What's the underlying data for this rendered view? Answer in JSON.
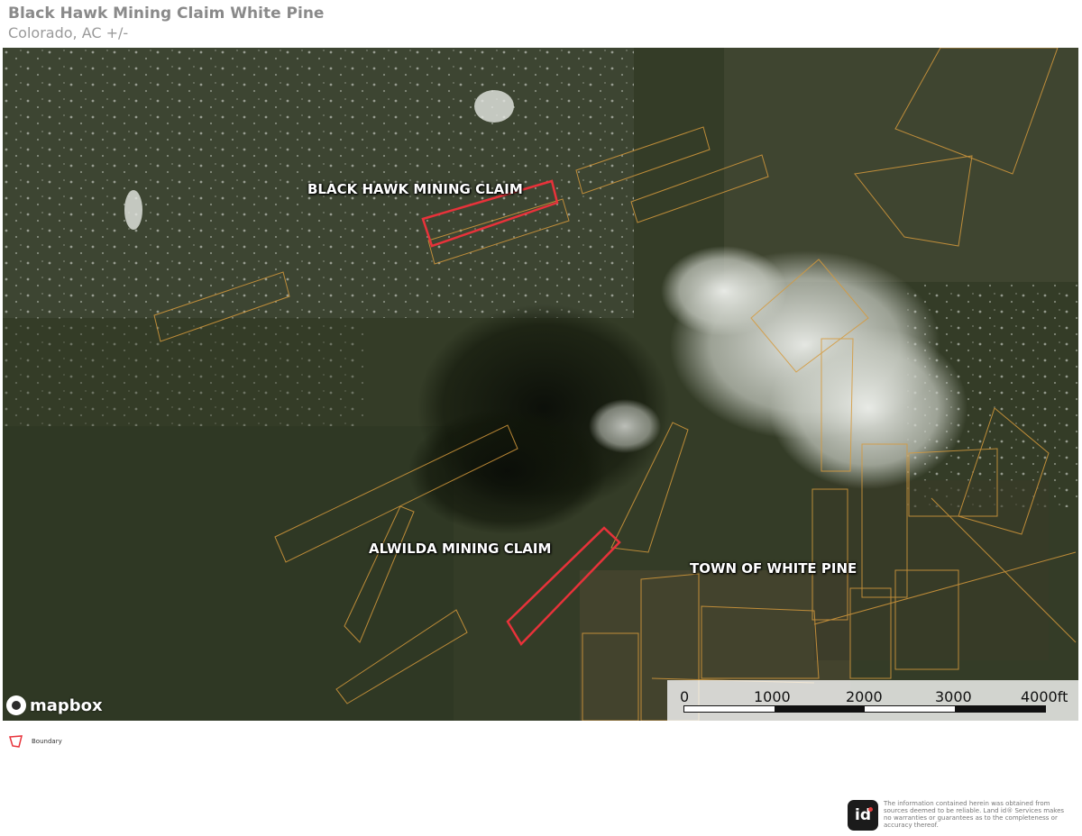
{
  "header": {
    "title": "Black Hawk Mining Claim White Pine",
    "subtitle": "Colorado,  AC +/-"
  },
  "map": {
    "labels": {
      "black_hawk": "BLACK HAWK MINING CLAIM",
      "alwilda": "ALWILDA MINING CLAIM",
      "town": "TOWN OF WHITE PINE"
    },
    "attribution": "mapbox",
    "scale": {
      "ticks": [
        "0",
        "1000",
        "2000",
        "3000",
        "4000ft"
      ]
    },
    "colors": {
      "boundary": "#e8323a",
      "parcel": "#d69a3c"
    }
  },
  "legend": {
    "boundary_label": "Boundary"
  },
  "footer": {
    "logo_text": "id",
    "disclaimer": "The information contained herein was obtained from sources deemed to be reliable. Land id® Services makes no warranties or guarantees as to the completeness or accuracy thereof."
  }
}
